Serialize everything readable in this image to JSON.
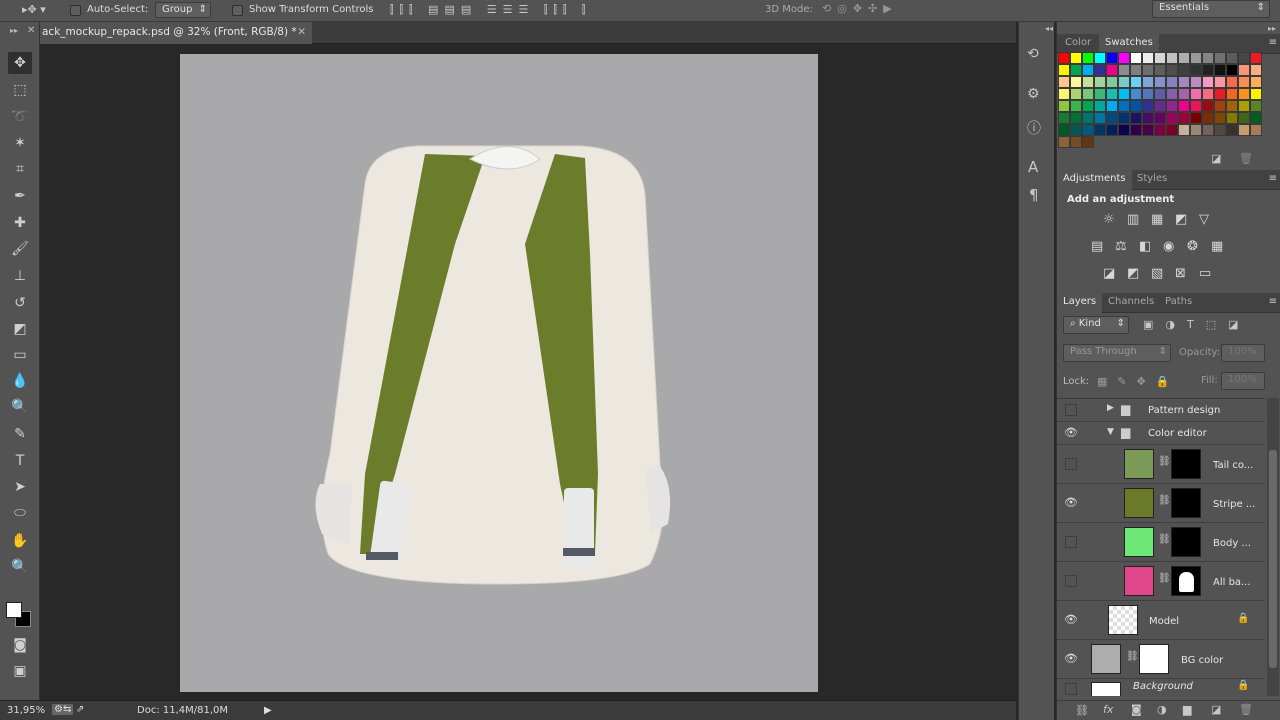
{
  "options_bar": {
    "auto_select_label": "Auto-Select:",
    "auto_select_checked": false,
    "group_select": "Group",
    "show_transform_label": "Show Transform Controls",
    "show_transform_checked": false,
    "mode_3d_label": "3D Mode:",
    "workspace": "Essentials"
  },
  "document": {
    "tab_title": "ack_mockup_repack.psd @ 32% (Front, RGB/8) *"
  },
  "panels": {
    "color_tab": "Color",
    "swatches_tab": "Swatches",
    "swatches": [
      "#ff0000",
      "#ffff00",
      "#00ff00",
      "#00ffff",
      "#0000ff",
      "#ff00ff",
      "#ffffff",
      "#ebebeb",
      "#d6d6d6",
      "#c2c2c2",
      "#adadad",
      "#999999",
      "#858585",
      "#707070",
      "#5c5c5c",
      "#474747",
      "#ed1c24",
      "#fff200",
      "#00a651",
      "#00aeef",
      "#2e3192",
      "#ec008c",
      "#8c8c8c",
      "#7f7f7f",
      "#6e6e6e",
      "#5e5e5e",
      "#4f4f4f",
      "#404040",
      "#333333",
      "#222222",
      "#111111",
      "#000000",
      "#f7977a",
      "#fbad82",
      "#fdc68a",
      "#fff799",
      "#c4df9b",
      "#a3d39c",
      "#82ca9c",
      "#7accc8",
      "#6dcff6",
      "#7da7d9",
      "#8393ca",
      "#8781bd",
      "#a187be",
      "#bc8dbf",
      "#f49ac2",
      "#f6989d",
      "#f26c4f",
      "#f68e55",
      "#fbaf5d",
      "#fff568",
      "#acd373",
      "#7cc576",
      "#3cb878",
      "#1cbbb4",
      "#00bff3",
      "#448ccb",
      "#5574b9",
      "#605ca8",
      "#855fa8",
      "#a863a8",
      "#f06eaa",
      "#f26d7d",
      "#ed1c24",
      "#f26522",
      "#f7941d",
      "#fff200",
      "#8dc63f",
      "#39b54a",
      "#00a651",
      "#00a99d",
      "#00aeef",
      "#0072bc",
      "#0054a6",
      "#2e3192",
      "#662d91",
      "#92278f",
      "#ec008c",
      "#ed145b",
      "#9e0b0f",
      "#a0410d",
      "#a36209",
      "#aba000",
      "#598527",
      "#197b30",
      "#007236",
      "#00746b",
      "#0076a3",
      "#004b80",
      "#003471",
      "#1b1464",
      "#440e62",
      "#630460",
      "#9e005d",
      "#9e0039",
      "#790000",
      "#7b2e00",
      "#7d4900",
      "#827b00",
      "#406618",
      "#005e20",
      "#005826",
      "#005952",
      "#005b7f",
      "#003663",
      "#002157",
      "#0d004c",
      "#32004b",
      "#4b0049",
      "#7b0046",
      "#7a0026",
      "#c7b299",
      "#998675",
      "#736357",
      "#534741",
      "#37302d",
      "#c69c6d",
      "#a67c52",
      "#8c6239",
      "#754c24",
      "#603913"
    ],
    "adjustments_tab": "Adjustments",
    "styles_tab": "Styles",
    "add_adjustment": "Add an adjustment",
    "layers_tab": "Layers",
    "channels_tab": "Channels",
    "paths_tab": "Paths",
    "filter_kind": "Kind",
    "blend_mode": "Pass Through",
    "opacity_label": "Opacity:",
    "opacity_value": "100%",
    "lock_label": "Lock:",
    "fill_label": "Fill:",
    "fill_value": "100%",
    "layers": [
      {
        "name": "Pattern design",
        "type": "group",
        "expanded": false,
        "visible": false
      },
      {
        "name": "Color editor",
        "type": "group",
        "expanded": true,
        "visible": true
      },
      {
        "name": "Tail co...",
        "type": "fill",
        "color": "#7a9a55",
        "visible": false
      },
      {
        "name": "Stripe ...",
        "type": "fill",
        "color": "#6b7a2a",
        "visible": true
      },
      {
        "name": "Body ...",
        "type": "fill",
        "color": "#6fe87a",
        "visible": false
      },
      {
        "name": "All ba...",
        "type": "fill",
        "color": "#e0468a",
        "visible": false
      },
      {
        "name": "Model",
        "type": "smart",
        "visible": true,
        "locked": true
      },
      {
        "name": "BG color",
        "type": "fill",
        "color": "#adadad",
        "visible": true
      },
      {
        "name": "Background",
        "type": "background",
        "visible": false,
        "locked": true
      }
    ]
  },
  "status": {
    "zoom": "31,95%",
    "doc_size": "Doc: 11,4M/81,0M"
  },
  "colors": {
    "canvas_bg": "#a9a9ab",
    "strap_green": "#6b7d2a",
    "bag_body": "#ece8df",
    "ui_panel": "#535353"
  }
}
